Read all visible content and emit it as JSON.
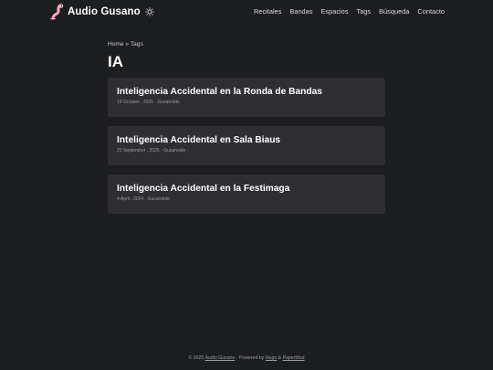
{
  "header": {
    "site_title": "Audio Gusano",
    "logo_icon": "worm-icon",
    "theme_icon": "sun-icon",
    "menu": [
      {
        "label": "Recitales"
      },
      {
        "label": "Bandas"
      },
      {
        "label": "Espacios"
      },
      {
        "label": "Tags"
      },
      {
        "label": "Búsqueda"
      },
      {
        "label": "Contacto"
      }
    ]
  },
  "breadcrumb": {
    "home": "Home",
    "separator": " » ",
    "tags": "Tags"
  },
  "page_title": "IA",
  "posts": [
    {
      "title": "Inteligencia Accidental en la Ronda de Bandas",
      "date": "19 October , 2025",
      "author": "Gusanoide"
    },
    {
      "title": "Inteligencia Accidental en Sala Biaus",
      "date": "20 September , 2025",
      "author": "Gusanoide"
    },
    {
      "title": "Inteligencia Accidental en la Festimaga",
      "date": "4 April , 2024",
      "author": "Gusanoide"
    }
  ],
  "meta_separator": " · ",
  "footer": {
    "copyright": "© 2025 ",
    "site_link": "Audio Gusano",
    "powered_by": " · Powered by ",
    "hugo": "Hugo",
    "amp": " & ",
    "papermod": "PaperMod"
  },
  "colors": {
    "background": "#1d1e20",
    "card": "#2e2e33",
    "logo_pink": "#f7a6c1"
  }
}
